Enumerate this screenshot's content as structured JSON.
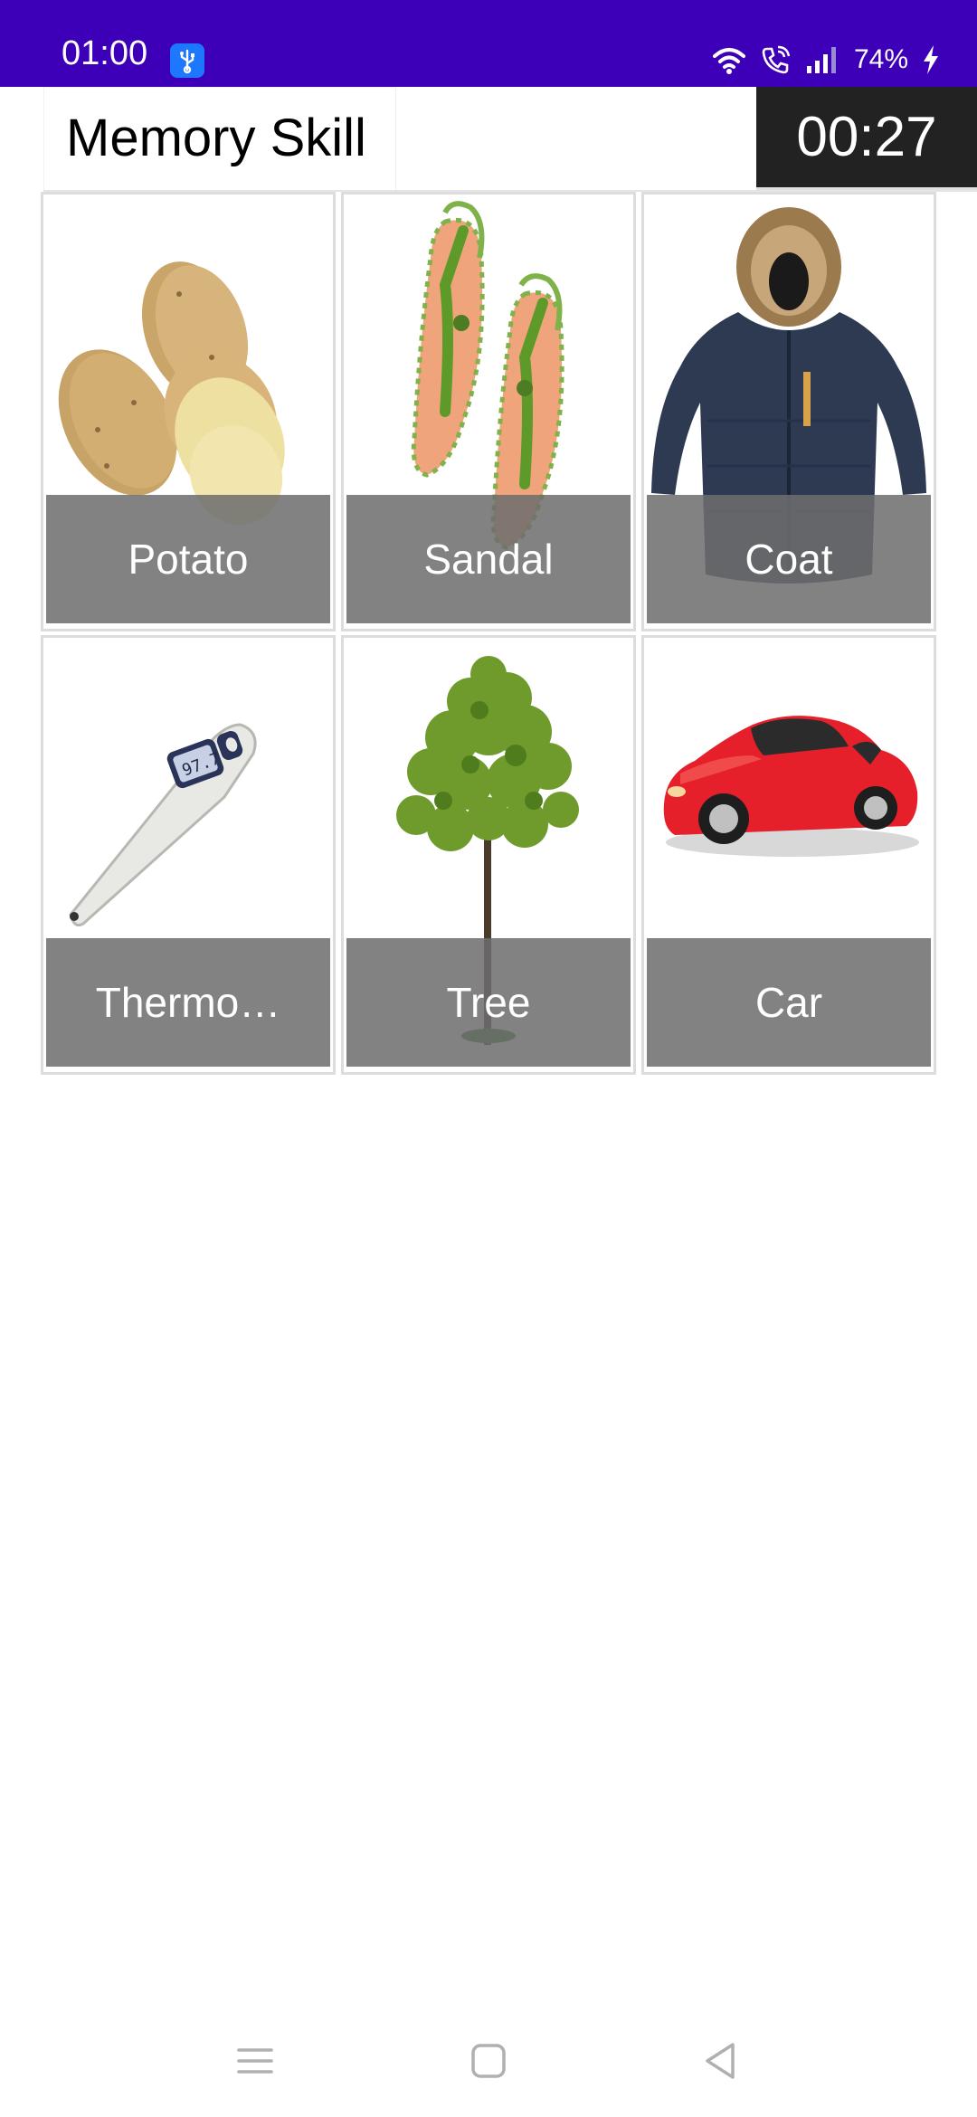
{
  "status_bar": {
    "time": "01:00",
    "battery": "74%",
    "icons": [
      "usb-icon",
      "wifi-icon",
      "wifi-calling-icon",
      "signal-icon",
      "battery-charging-icon"
    ],
    "background": "#3d00b8"
  },
  "header": {
    "title": "Memory Skill",
    "timer": "00:27"
  },
  "cards": [
    {
      "label": "Potato",
      "image": "potato-image"
    },
    {
      "label": "Sandal",
      "image": "sandal-image"
    },
    {
      "label": "Coat",
      "image": "coat-image"
    },
    {
      "label": "Thermo…",
      "image": "thermometer-image"
    },
    {
      "label": "Tree",
      "image": "tree-image"
    },
    {
      "label": "Car",
      "image": "car-image"
    }
  ],
  "nav_bar": {
    "icons": [
      "menu-icon",
      "home-icon",
      "back-icon"
    ]
  }
}
